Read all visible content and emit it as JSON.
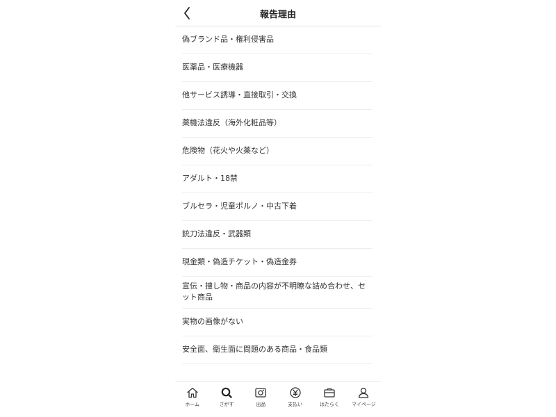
{
  "header": {
    "title": "報告理由"
  },
  "reasons": [
    "偽ブランド品・権利侵害品",
    "医薬品・医療機器",
    "他サービス誘導・直接取引・交換",
    "薬機法違反（海外化粧品等）",
    "危険物（花火や火薬など）",
    "アダルト・18禁",
    "ブルセラ・児童ポルノ・中古下着",
    "銃刀法違反・武器類",
    "現金類・偽造チケット・偽造金券",
    "宣伝・捜し物・商品の内容が不明瞭な詰め合わせ、セット商品",
    "実物の画像がない",
    "安全面、衛生面に問題のある商品・食品類"
  ],
  "tabs": [
    {
      "label": "ホーム",
      "icon": "home-icon"
    },
    {
      "label": "さがす",
      "icon": "search-icon"
    },
    {
      "label": "出品",
      "icon": "camera-icon"
    },
    {
      "label": "支払い",
      "icon": "yen-icon"
    },
    {
      "label": "はたらく",
      "icon": "briefcase-icon"
    },
    {
      "label": "マイページ",
      "icon": "person-icon"
    }
  ]
}
